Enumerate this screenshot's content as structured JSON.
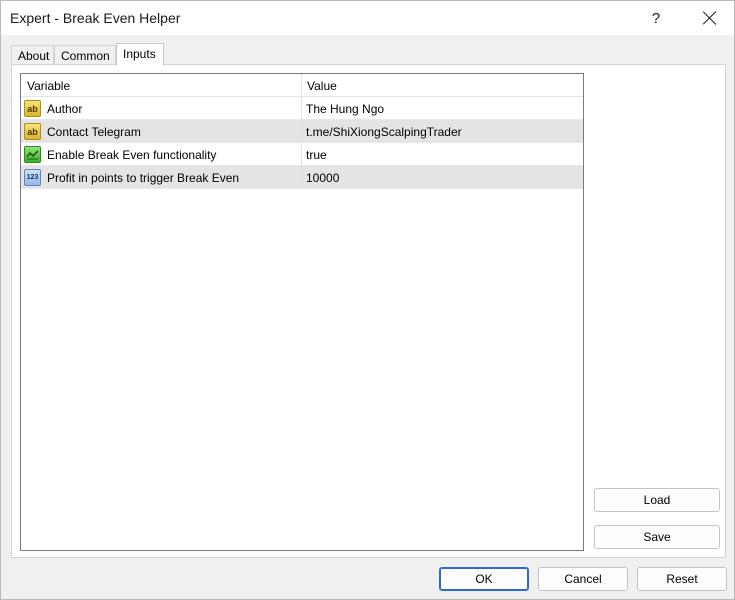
{
  "window": {
    "title": "Expert - Break Even Helper",
    "help_glyph": "?"
  },
  "tabs": [
    {
      "label": "About"
    },
    {
      "label": "Common"
    },
    {
      "label": "Inputs",
      "active": true
    }
  ],
  "grid": {
    "columns": {
      "variable": "Variable",
      "value": "Value"
    },
    "rows": [
      {
        "icon": "string-ab-icon",
        "icon_text": "ab",
        "name": "Author",
        "value": "The Hung Ngo"
      },
      {
        "icon": "string-ab-icon",
        "icon_text": "ab",
        "name": "Contact Telegram",
        "value": "t.me/ShiXiongScalpingTrader"
      },
      {
        "icon": "boolean-icon",
        "icon_text": "",
        "name": "Enable Break Even functionality",
        "value": "true"
      },
      {
        "icon": "number-123-icon",
        "icon_text": "123",
        "name": "Profit in points to trigger Break Even",
        "value": "10000"
      }
    ]
  },
  "side_buttons": {
    "load": "Load",
    "save": "Save"
  },
  "footer_buttons": {
    "ok": "OK",
    "cancel": "Cancel",
    "reset": "Reset"
  }
}
